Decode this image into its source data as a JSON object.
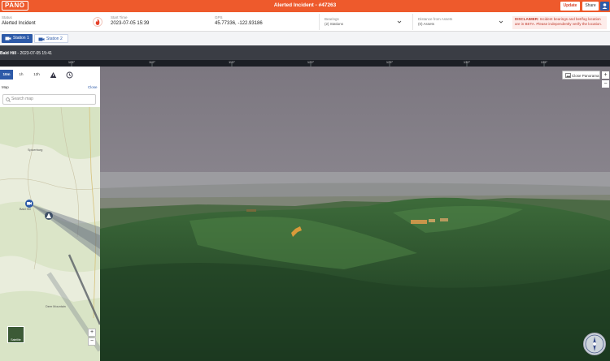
{
  "app": {
    "logo": "PANO",
    "title": "Alerted Incident - #47263"
  },
  "header_actions": {
    "update": "Update",
    "share": "Share",
    "user_icon": "user-icon"
  },
  "incident": {
    "status_label": "Status",
    "status_value": "Alerted Incident",
    "start_label": "Start Time",
    "start_value": "2023-07-05 15:39",
    "gps_label": "GPS",
    "gps_value": "45.77336, -122.93186",
    "bearings_label": "Bearings",
    "bearings_value": "(2) Stations",
    "distance_label": "Distance from Assets",
    "distance_value": "(0) Assets"
  },
  "disclaimer": {
    "title": "DISCLAIMER:",
    "text": "Incident bearings and bet/fog location are in BETA. Please independently verify the location."
  },
  "stations": [
    {
      "label": "Station 1",
      "active": true
    },
    {
      "label": "Station 2",
      "active": false
    }
  ],
  "camera": {
    "name": "Bald Hill",
    "timestamp": " - 2023-07-05 15:41"
  },
  "ruler": {
    "ticks": [
      "105°",
      "110°",
      "115°",
      "120°",
      "125°",
      "130°",
      "135°"
    ]
  },
  "panorama": {
    "close_label": "Close Panorama",
    "zoom_in": "+",
    "zoom_out": "−"
  },
  "left_panel": {
    "time_tabs": [
      "10m",
      "1h",
      "12h"
    ],
    "map_label": "Map",
    "close_label": "Close",
    "search_placeholder": "Search map",
    "satellite_label": "Satellite",
    "zoom_in": "+",
    "zoom_out": "−",
    "place_names": [
      "Spicerburg",
      "Bald Hill",
      "Deer Mountain"
    ]
  },
  "colors": {
    "brand": "#ee5a2c",
    "accent": "#2d5aa8",
    "alert": "#c0392b"
  }
}
